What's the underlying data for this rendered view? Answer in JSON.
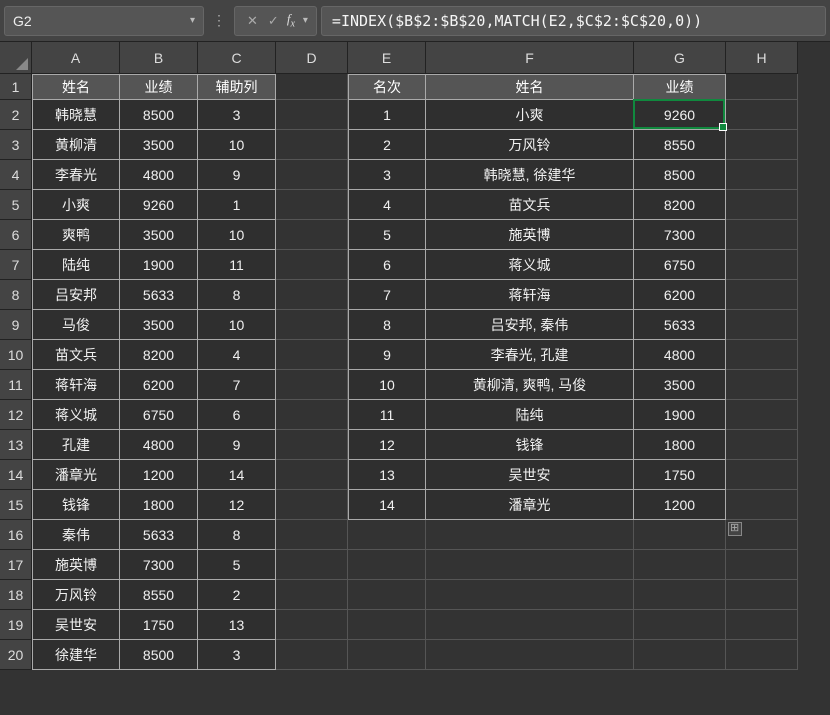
{
  "nameBox": "G2",
  "formula": "=INDEX($B$2:$B$20,MATCH(E2,$C$2:$C$20,0))",
  "columns": [
    "A",
    "B",
    "C",
    "D",
    "E",
    "F",
    "G",
    "H"
  ],
  "colWidths": {
    "A": 88,
    "B": 78,
    "C": 78,
    "D": 72,
    "E": 78,
    "F": 208,
    "G": 92,
    "H": 72
  },
  "leftHeader": {
    "A": "姓名",
    "B": "业绩",
    "C": "辅助列"
  },
  "rightHeader": {
    "E": "名次",
    "F": "姓名",
    "G": "业绩"
  },
  "leftRows": [
    {
      "A": "韩晓慧",
      "B": "8500",
      "C": "3"
    },
    {
      "A": "黄柳清",
      "B": "3500",
      "C": "10"
    },
    {
      "A": "李春光",
      "B": "4800",
      "C": "9"
    },
    {
      "A": "小爽",
      "B": "9260",
      "C": "1"
    },
    {
      "A": "爽鸭",
      "B": "3500",
      "C": "10"
    },
    {
      "A": "陆纯",
      "B": "1900",
      "C": "11"
    },
    {
      "A": "吕安邦",
      "B": "5633",
      "C": "8"
    },
    {
      "A": "马俊",
      "B": "3500",
      "C": "10"
    },
    {
      "A": "苗文兵",
      "B": "8200",
      "C": "4"
    },
    {
      "A": "蒋轩海",
      "B": "6200",
      "C": "7"
    },
    {
      "A": "蒋义城",
      "B": "6750",
      "C": "6"
    },
    {
      "A": "孔建",
      "B": "4800",
      "C": "9"
    },
    {
      "A": "潘章光",
      "B": "1200",
      "C": "14"
    },
    {
      "A": "钱锋",
      "B": "1800",
      "C": "12"
    },
    {
      "A": "秦伟",
      "B": "5633",
      "C": "8"
    },
    {
      "A": "施英博",
      "B": "7300",
      "C": "5"
    },
    {
      "A": "万风铃",
      "B": "8550",
      "C": "2"
    },
    {
      "A": "吴世安",
      "B": "1750",
      "C": "13"
    },
    {
      "A": "徐建华",
      "B": "8500",
      "C": "3"
    }
  ],
  "rightRows": [
    {
      "E": "1",
      "F": "小爽",
      "G": "9260"
    },
    {
      "E": "2",
      "F": "万风铃",
      "G": "8550"
    },
    {
      "E": "3",
      "F": "韩晓慧, 徐建华",
      "G": "8500"
    },
    {
      "E": "4",
      "F": "苗文兵",
      "G": "8200"
    },
    {
      "E": "5",
      "F": "施英博",
      "G": "7300"
    },
    {
      "E": "6",
      "F": "蒋义城",
      "G": "6750"
    },
    {
      "E": "7",
      "F": "蒋轩海",
      "G": "6200"
    },
    {
      "E": "8",
      "F": "吕安邦, 秦伟",
      "G": "5633"
    },
    {
      "E": "9",
      "F": "李春光, 孔建",
      "G": "4800"
    },
    {
      "E": "10",
      "F": "黄柳清, 爽鸭, 马俊",
      "G": "3500"
    },
    {
      "E": "11",
      "F": "陆纯",
      "G": "1900"
    },
    {
      "E": "12",
      "F": "钱锋",
      "G": "1800"
    },
    {
      "E": "13",
      "F": "吴世安",
      "G": "1750"
    },
    {
      "E": "14",
      "F": "潘章光",
      "G": "1200"
    }
  ],
  "selectedCell": "G2"
}
